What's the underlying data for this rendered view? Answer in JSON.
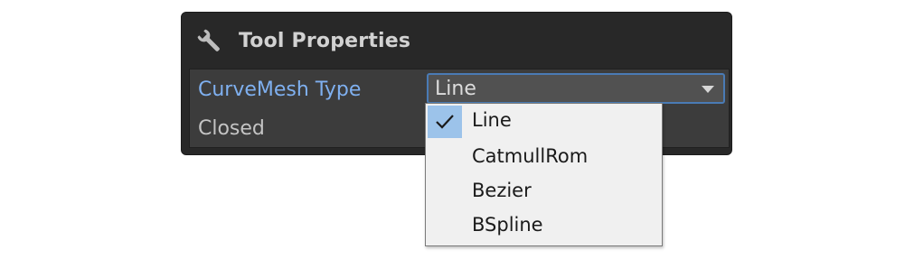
{
  "panel": {
    "title": "Tool Properties",
    "icon": "wrench-icon"
  },
  "properties": [
    {
      "label": "CurveMesh Type",
      "value": "Line"
    },
    {
      "label": "Closed"
    }
  ],
  "dropdown": {
    "selected": "Line",
    "options": [
      "Line",
      "CatmullRom",
      "Bezier",
      "BSpline"
    ]
  },
  "colors": {
    "panel_bg": "#282828",
    "property_bg": "#3c3c3c",
    "active_label": "#7fb0f0",
    "focus_border": "#4a7bb5",
    "menu_bg": "#f0f0f0",
    "check_highlight": "#9cc3ea"
  }
}
